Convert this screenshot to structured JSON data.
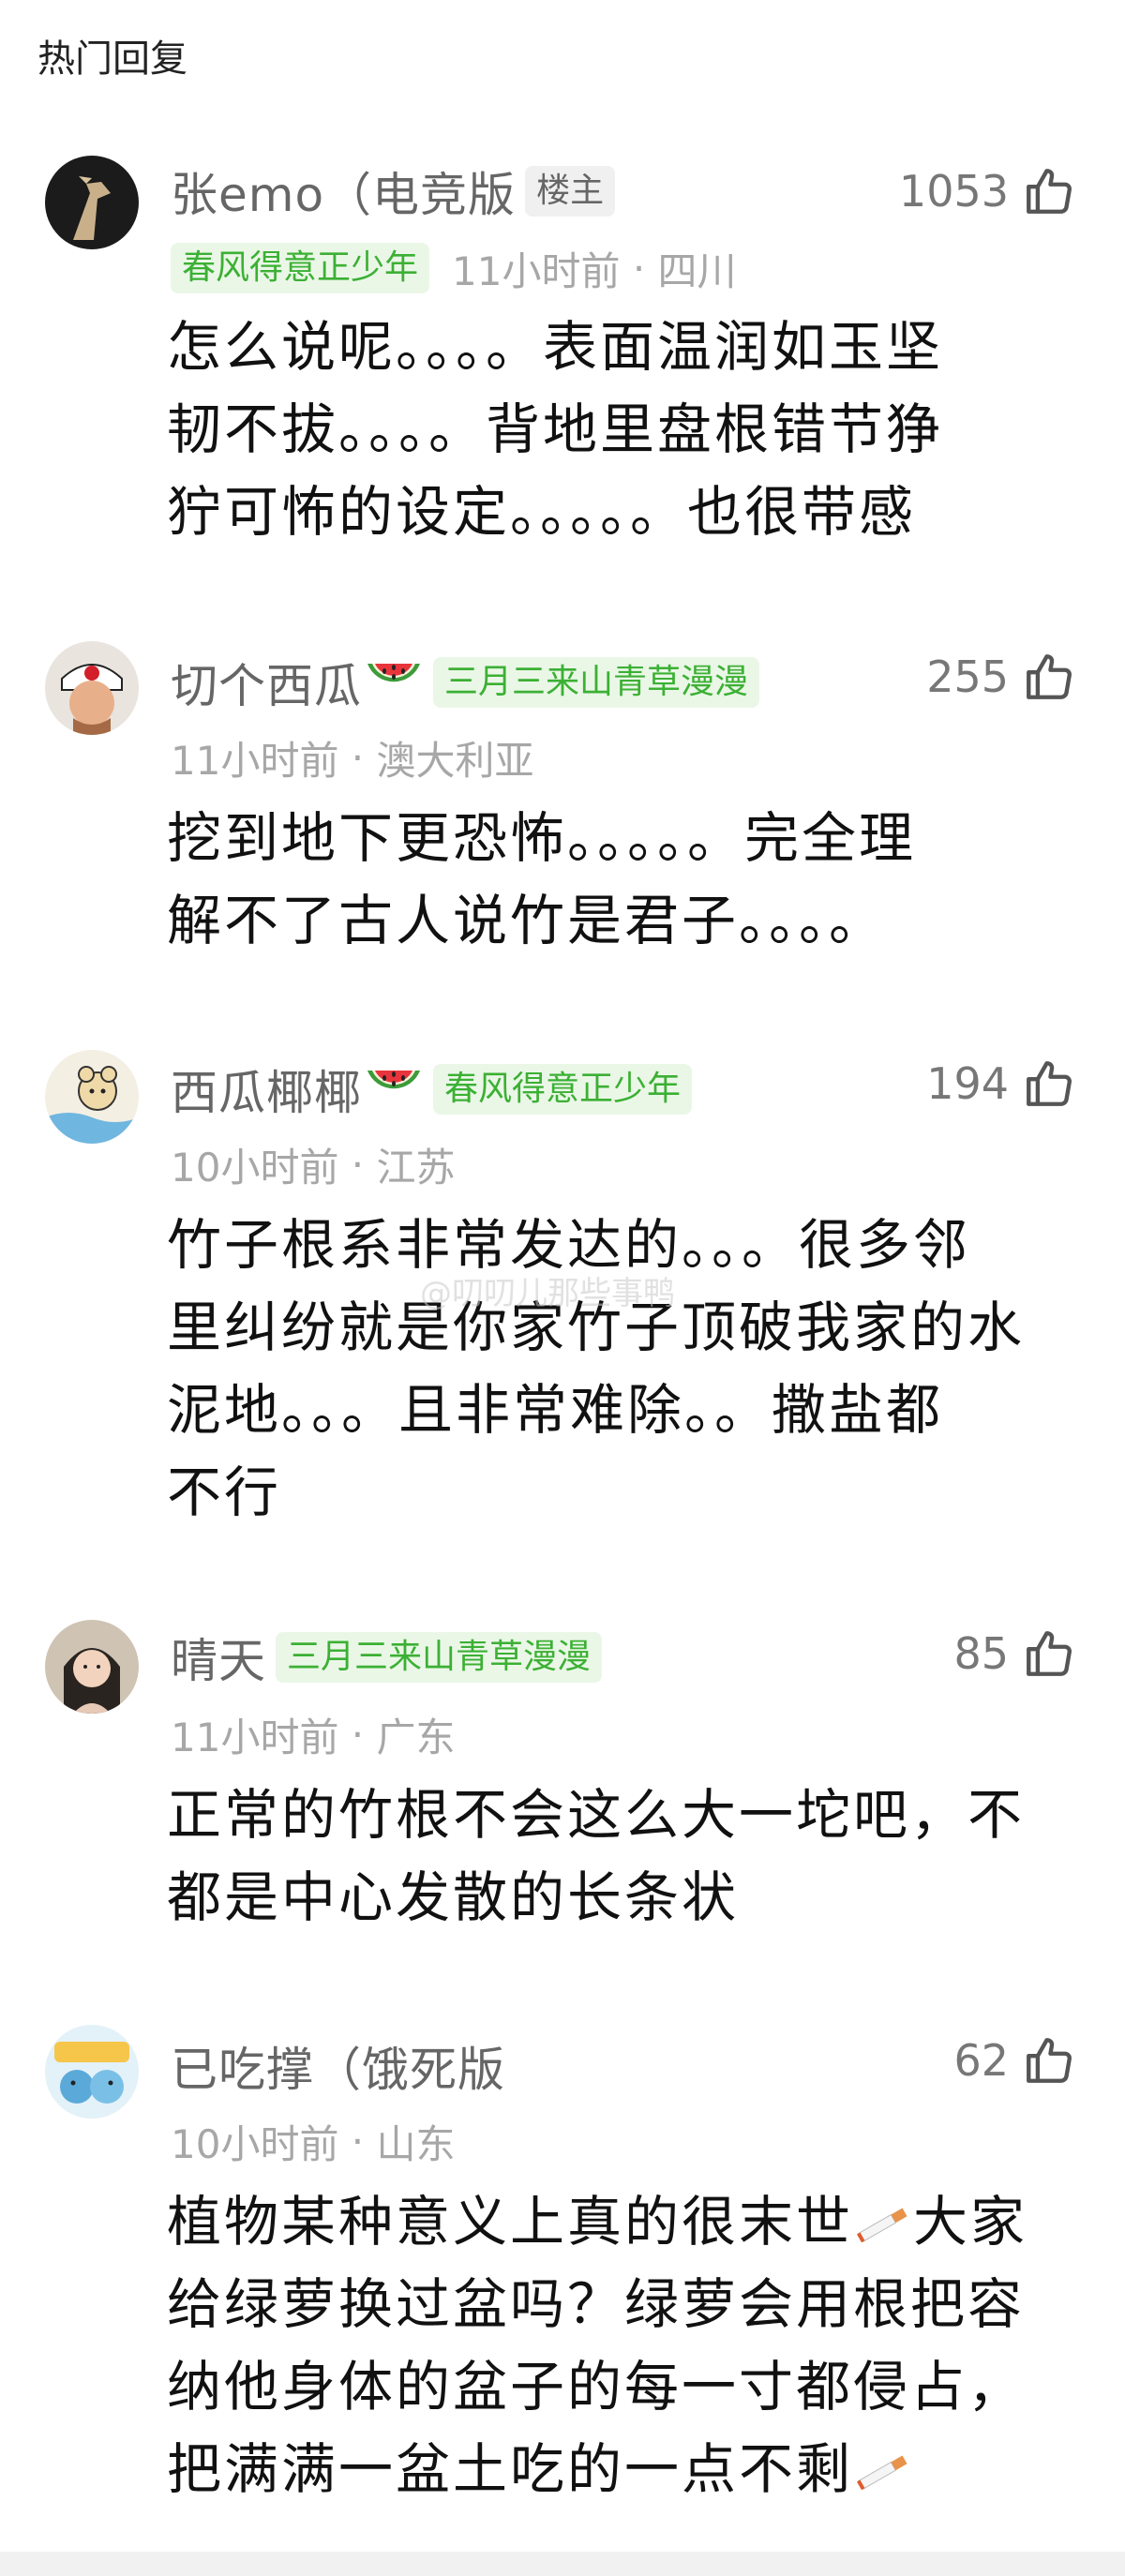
{
  "section_title": "热门回复",
  "watermark": "@叨叨儿那些事鸭",
  "comments": [
    {
      "username": "张emo（电竞版",
      "badge": "楼主",
      "title_badge": "春风得意正少年",
      "time": "11小时前",
      "location": "四川",
      "likes": "1053",
      "lines": [
        "怎么说呢。。。。表面温润如玉坚",
        "韧不拔。。。。背地里盘根错节狰",
        "狞可怖的设定。。。。。也很带感"
      ]
    },
    {
      "username": "切个西瓜",
      "emoji": "watermelon-emoji",
      "title_badge": "三月三来山青草漫漫",
      "time": "11小时前",
      "location": "澳大利亚",
      "likes": "255",
      "lines": [
        "挖到地下更恐怖。。。。。完全理",
        "解不了古人说竹是君子。。。。"
      ]
    },
    {
      "username": "西瓜椰椰",
      "emoji": "watermelon-emoji",
      "title_badge": "春风得意正少年",
      "time": "10小时前",
      "location": "江苏",
      "likes": "194",
      "lines": [
        "竹子根系非常发达的。。。很多邻",
        "里纠纷就是你家竹子顶破我家的水",
        "泥地。。。且非常难除。。撒盐都",
        "不行"
      ]
    },
    {
      "username": "晴天",
      "title_badge": "三月三来山青草漫漫",
      "time": "11小时前",
      "location": "广东",
      "likes": "85",
      "lines": [
        "正常的竹根不会这么大一坨吧，不",
        "都是中心发散的长条状"
      ]
    },
    {
      "username": "已吃撑（饿死版",
      "time": "10小时前",
      "location": "山东",
      "likes": "62",
      "lines": [
        "植物某种意义上真的很末世",
        "大家",
        "给绿萝换过盆吗？绿萝会用根把容",
        "纳他身体的盆子的每一寸都侵占，",
        "把满满一盆土吃的一点不剩"
      ]
    }
  ],
  "colors": {
    "badge_green_text": "#3cb034",
    "badge_green_bg": "#eaf7e7",
    "meta": "#a7a7a7",
    "username": "#666666"
  }
}
